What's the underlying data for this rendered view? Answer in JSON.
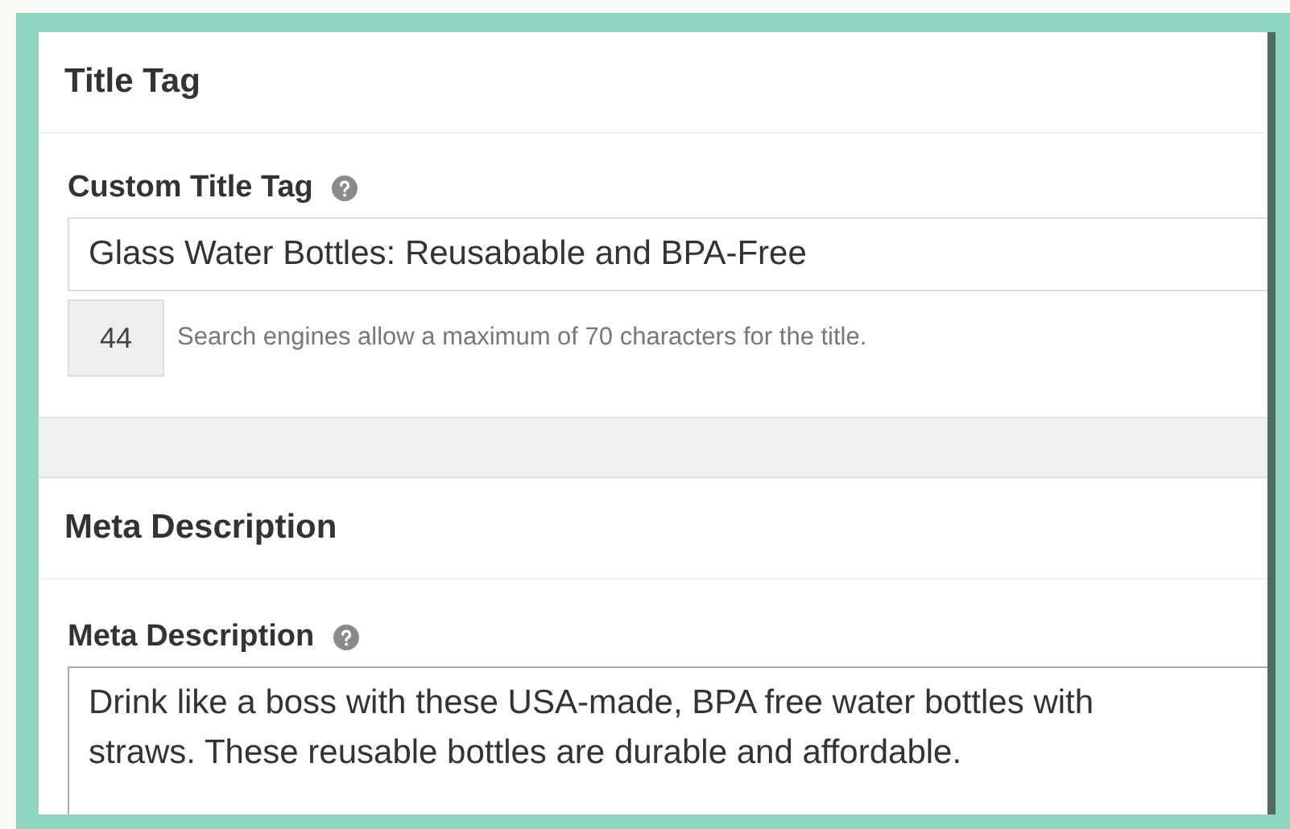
{
  "sections": [
    {
      "heading": "Title Tag",
      "field": {
        "kind": "input",
        "label": "Custom Title Tag",
        "value": "Glass Water Bottles: Reusabable and BPA-Free",
        "count": "44",
        "hint": "Search engines allow a maximum of 70 characters for the title."
      }
    },
    {
      "heading": "Meta Description",
      "field": {
        "kind": "textarea",
        "label": "Meta Description",
        "value": "Drink like a boss with these USA-made, BPA free water bottles with straws. These reusable bottles are durable and affordable."
      }
    }
  ]
}
